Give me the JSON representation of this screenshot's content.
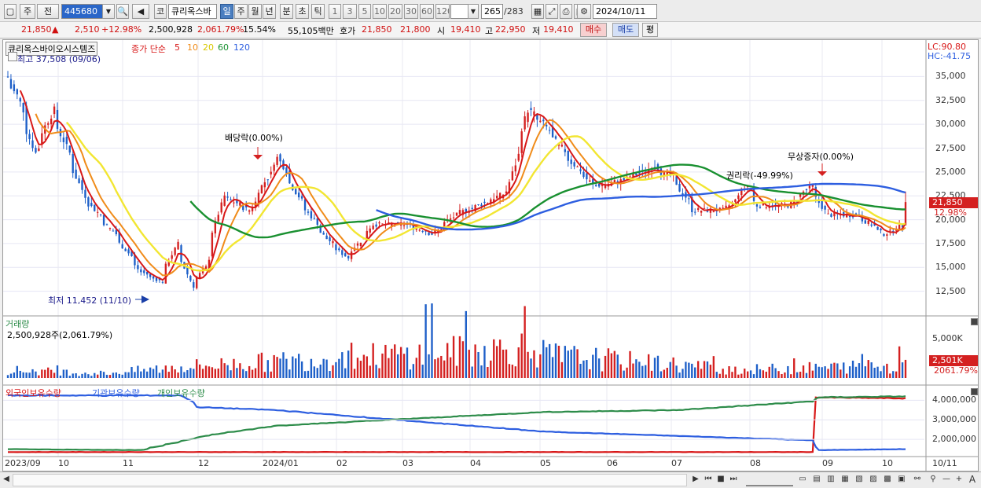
{
  "toolbar": {
    "menu1": "주",
    "menu2": "전",
    "code": "445680",
    "type_label": "코",
    "stock_name": "큐리옥스바",
    "periods": [
      "일",
      "주",
      "월",
      "년",
      "분",
      "초",
      "틱"
    ],
    "active_period": "일",
    "intervals": [
      "1",
      "3",
      "5",
      "10",
      "20",
      "30",
      "60",
      "120"
    ],
    "count": "265",
    "count_total": "/283",
    "date": "2024/10/11"
  },
  "quote": {
    "price": "21,850",
    "change_arrow": "▲",
    "change": "2,510",
    "change_pct": "+12.98%",
    "volume": "2,500,928",
    "volume_ratio": "2,061.79%",
    "turnover": "15.54%",
    "amount": "55,105백만",
    "ask_label": "호가",
    "ask": "21,850",
    "bid": "21,800",
    "open_label": "시",
    "open": "19,410",
    "high_label": "고",
    "high": "22,950",
    "low_label": "저",
    "low": "19,410",
    "buy_btn": "매수",
    "sell_btn": "매도",
    "eval_btn": "평"
  },
  "price_pane": {
    "name": "큐리옥스바이오시스템즈",
    "ma_title": "종가 단순",
    "ma_periods": [
      "5",
      "10",
      "20",
      "60",
      "120"
    ],
    "high_note": "최고 37,508 (09/06)",
    "low_note": "최저 11,452 (11/10)",
    "event1": "배당락(0.00%)",
    "event2": "권리락(-49.99%)",
    "event3": "무상증자(0.00%)",
    "lc": "LC:90.80",
    "hc": "HC:-41.75",
    "yticks": [
      "35,000",
      "32,500",
      "30,000",
      "27,500",
      "25,000",
      "22,500",
      "20,000",
      "17,500",
      "15,000",
      "12,500"
    ],
    "last_price": "21,850",
    "last_pct": "12.98%"
  },
  "volume_pane": {
    "title": "거래량",
    "value": "2,500,928주(2,061.79%)",
    "ytick": "5,000K",
    "last": "2,501K",
    "last_pct": "2061.79%"
  },
  "holdings_pane": {
    "series": [
      "외국인보유수량",
      "기관보유수량",
      "개인보유수량"
    ],
    "yticks": [
      "4,000,000",
      "3,000,000",
      "2,000,000"
    ]
  },
  "xaxis": [
    "2023/09",
    "10",
    "11",
    "12",
    "2024/01",
    "02",
    "03",
    "04",
    "05",
    "06",
    "07",
    "08",
    "09",
    "10",
    "10/11"
  ],
  "colors": {
    "up": "#d42020",
    "down": "#1d5fc8",
    "ma5": "#d81818",
    "ma10": "#f08c1a",
    "ma20": "#f2e632",
    "ma60": "#199030",
    "ma120": "#2d5ee0",
    "foreign": "#d81818",
    "institution": "#2d5ee0",
    "individual": "#2d8c4a"
  },
  "chart_data": {
    "type": "candlestick",
    "y_range": [
      10000,
      38000
    ],
    "price_keyframes": [
      [
        "2023-09-01",
        35000
      ],
      [
        "2023-09-06",
        33000
      ],
      [
        "2023-09-14",
        27000
      ],
      [
        "2023-09-22",
        31500
      ],
      [
        "2023-10-06",
        22500
      ],
      [
        "2023-10-20",
        18500
      ],
      [
        "2023-11-01",
        14500
      ],
      [
        "2023-11-10",
        13500
      ],
      [
        "2023-11-17",
        17500
      ],
      [
        "2023-11-24",
        13000
      ],
      [
        "2023-11-30",
        15000
      ],
      [
        "2023-12-08",
        22500
      ],
      [
        "2023-12-20",
        21000
      ],
      [
        "2024-01-02",
        26500
      ],
      [
        "2024-01-12",
        22000
      ],
      [
        "2024-01-24",
        18000
      ],
      [
        "2024-02-02",
        16000
      ],
      [
        "2024-02-14",
        19500
      ],
      [
        "2024-02-29",
        19500
      ],
      [
        "2024-03-12",
        18500
      ],
      [
        "2024-03-22",
        20500
      ],
      [
        "2024-04-02",
        21500
      ],
      [
        "2024-04-15",
        23000
      ],
      [
        "2024-04-24",
        31500
      ],
      [
        "2024-05-01",
        30000
      ],
      [
        "2024-05-14",
        26000
      ],
      [
        "2024-05-24",
        23500
      ],
      [
        "2024-06-04",
        24000
      ],
      [
        "2024-06-20",
        25500
      ],
      [
        "2024-06-28",
        24500
      ],
      [
        "2024-07-08",
        21000
      ],
      [
        "2024-07-22",
        21000
      ],
      [
        "2024-08-01",
        23500
      ],
      [
        "2024-08-06",
        21500
      ],
      [
        "2024-08-20",
        21500
      ],
      [
        "2024-08-30",
        23500
      ],
      [
        "2024-09-06",
        20500
      ],
      [
        "2024-09-20",
        20500
      ],
      [
        "2024-10-02",
        18500
      ],
      [
        "2024-10-10",
        19340
      ],
      [
        "2024-10-11",
        21850
      ]
    ],
    "volume_keyframes": [
      [
        "2023-09-01",
        1600
      ],
      [
        "2023-10-15",
        900
      ],
      [
        "2023-11-20",
        2200
      ],
      [
        "2024-04-26",
        6000
      ],
      [
        "2024-05-02",
        4500
      ],
      [
        "2024-07-31",
        1600
      ],
      [
        "2024-10-11",
        2501
      ]
    ],
    "holdings": {
      "foreign": [
        [
          "2023-09-01",
          1350000
        ],
        [
          "2024-08-31",
          1350000
        ],
        [
          "2024-09-02",
          4150000
        ],
        [
          "2024-10-11",
          4100000
        ]
      ],
      "institution": [
        [
          "2023-09-01",
          4250000
        ],
        [
          "2023-11-20",
          4250000
        ],
        [
          "2023-11-27",
          3650000
        ],
        [
          "2024-01-01",
          3500000
        ],
        [
          "2024-03-01",
          2950000
        ],
        [
          "2024-05-01",
          2400000
        ],
        [
          "2024-08-31",
          1950000
        ],
        [
          "2024-09-03",
          1450000
        ],
        [
          "2024-10-11",
          1500000
        ]
      ],
      "individual": [
        [
          "2023-09-01",
          1500000
        ],
        [
          "2023-11-01",
          1450000
        ],
        [
          "2023-12-01",
          2200000
        ],
        [
          "2024-01-01",
          2700000
        ],
        [
          "2024-03-01",
          3050000
        ],
        [
          "2024-05-01",
          3400000
        ],
        [
          "2024-07-01",
          3500000
        ],
        [
          "2024-08-31",
          3950000
        ],
        [
          "2024-09-03",
          4150000
        ],
        [
          "2024-10-11",
          4200000
        ]
      ]
    },
    "moving_averages": [
      5,
      10,
      20,
      60,
      120
    ]
  }
}
